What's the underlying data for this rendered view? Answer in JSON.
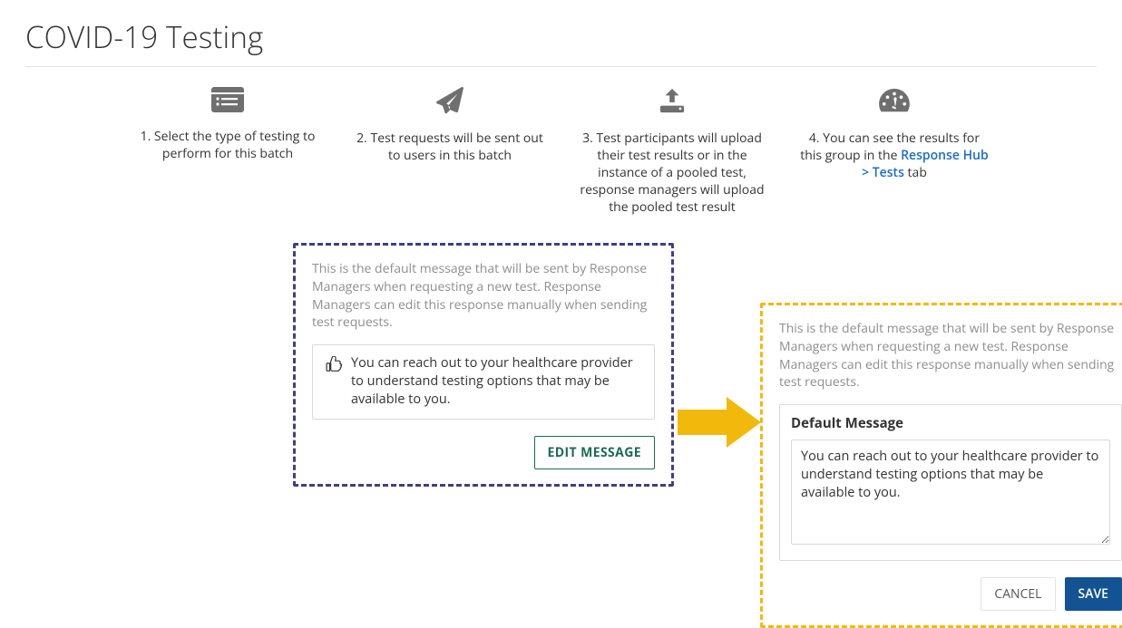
{
  "title": "COVID-19 Testing",
  "steps": [
    {
      "text": "1. Select the type of testing to perform for this batch"
    },
    {
      "text": "2. Test requests will be sent out to users in this batch"
    },
    {
      "text": "3. Test participants will upload their test results or in the instance of a pooled test, response managers will upload the pooled test result"
    },
    {
      "prefix": "4. You can see the results for this group in the ",
      "link": "Response Hub > Tests",
      "suffix": " tab"
    }
  ],
  "callout_left": {
    "desc": "This is the default message that will be sent by Response Managers when requesting a new test. Response Managers can edit this response manually when sending test requests.",
    "message": "You can reach out to your healthcare provider to understand testing options that may be available to you.",
    "edit_label": "EDIT MESSAGE"
  },
  "callout_right": {
    "desc": "This is the default message that will be sent by Response Managers when requesting a new test. Response Managers can edit this response manually when sending test requests.",
    "panel_label": "Default Message",
    "textarea_value": "You can reach out to your healthcare provider to understand testing options that may be available to you.",
    "cancel_label": "CANCEL",
    "save_label": "SAVE"
  }
}
